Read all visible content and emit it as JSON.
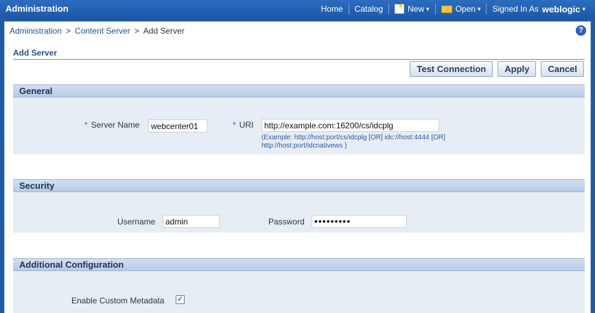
{
  "header": {
    "title": "Administration",
    "nav": {
      "home": "Home",
      "catalog": "Catalog",
      "new": "New",
      "open": "Open",
      "signed_in_as": "Signed In As",
      "user": "weblogic"
    }
  },
  "breadcrumb": {
    "items": [
      "Administration",
      "Content Server",
      "Add Server"
    ],
    "separator": ">"
  },
  "page": {
    "title": "Add Server"
  },
  "buttons": {
    "test_connection": "Test Connection",
    "apply": "Apply",
    "cancel": "Cancel"
  },
  "sections": {
    "general": {
      "title": "General",
      "server_name_label": "Server Name",
      "server_name_value": "webcenter01",
      "uri_label": "URI",
      "uri_value": "http://example.com:16200/cs/idcplg",
      "uri_hint_line1": "(Example: http://host:port/cs/idcplg [OR] idc://host:4444 [OR]",
      "uri_hint_line2": "http://host:port/idcnativews )",
      "required_marker": "*"
    },
    "security": {
      "title": "Security",
      "username_label": "Username",
      "username_value": "admin",
      "password_label": "Password",
      "password_value": "•••••••••"
    },
    "additional": {
      "title": "Additional Configuration",
      "custom_metadata_label": "Enable Custom Metadata",
      "custom_metadata_checked": "✓"
    }
  },
  "icons": {
    "help": "?",
    "chevron": "⌄"
  }
}
